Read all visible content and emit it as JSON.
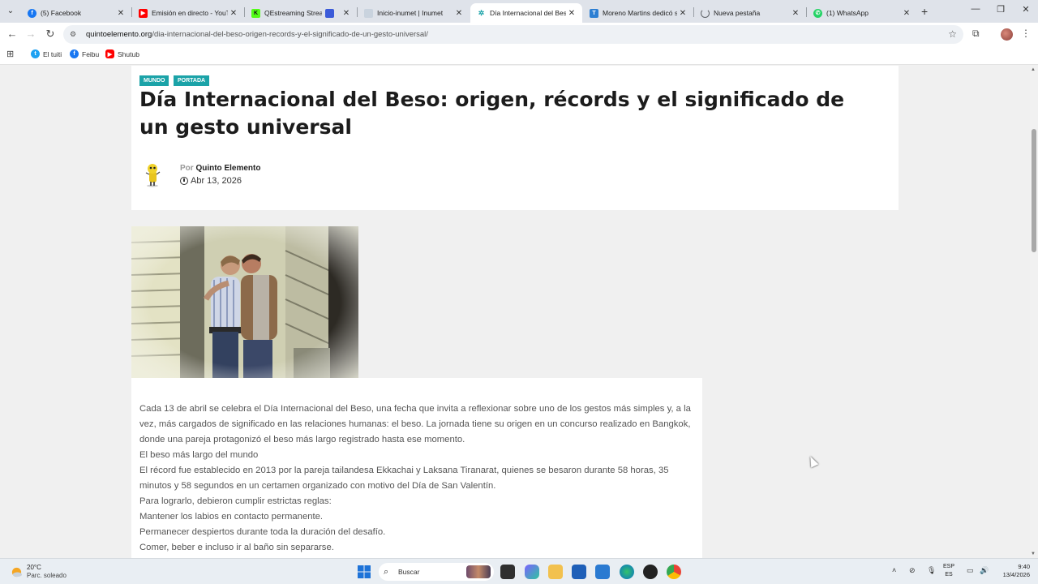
{
  "browser": {
    "tabs": [
      {
        "title": "(5) Facebook",
        "icon": "facebook-icon",
        "color": "#1877f2"
      },
      {
        "title": "Emisión en directo - YouTube",
        "icon": "youtube-icon",
        "color": "#ff0000"
      },
      {
        "title": "QEstreaming Stream",
        "icon": "kick-icon",
        "color": "#53fc18"
      },
      {
        "title": "Inicio-inumet | Inumet",
        "icon": "page-icon",
        "color": "#c9d3de"
      },
      {
        "title": "Día Internacional del Beso",
        "icon": "site-icon",
        "color": "#1ba3a8",
        "active": true
      },
      {
        "title": "Moreno Martins dedicó su",
        "icon": "doc-icon",
        "color": "#2d7fd3"
      },
      {
        "title": "Nueva pestaña",
        "icon": "loading-icon",
        "color": "#5f6368"
      },
      {
        "title": "(1) WhatsApp",
        "icon": "whatsapp-icon",
        "color": "#25d366"
      }
    ],
    "url_host": "quintoelemento.org",
    "url_path": "/dia-internacional-del-beso-origen-records-y-el-significado-de-un-gesto-universal/",
    "bookmarks": [
      {
        "label": "El tuiti",
        "icon": "twitter-icon",
        "color": "#1da1f2"
      },
      {
        "label": "Feibu",
        "icon": "facebook-icon",
        "color": "#1877f2"
      },
      {
        "label": "Shutub",
        "icon": "youtube-icon",
        "color": "#ff0000"
      }
    ]
  },
  "article": {
    "categories": [
      "MUNDO",
      "PORTADA"
    ],
    "title": "Día Internacional del Beso: origen, récords y el significado de un gesto universal",
    "by_prefix": "Por",
    "author": "Quinto Elemento",
    "date": "Abr 13, 2026",
    "paragraphs": [
      "Cada 13 de abril se celebra el Día Internacional del Beso, una fecha que invita a reflexionar sobre uno de los gestos más simples y, a la vez, más cargados de significado en las relaciones humanas: el beso. La jornada tiene su origen en un concurso realizado en Bangkok, donde una pareja protagonizó el beso más largo registrado hasta ese momento.",
      "El beso más largo del mundo",
      "El récord fue establecido en 2013 por la pareja tailandesa Ekkachai y Laksana Tiranarat, quienes se besaron durante 58 horas, 35 minutos y 58 segundos en un certamen organizado con motivo del Día de San Valentín.",
      "Para lograrlo, debieron cumplir estrictas reglas:",
      "Mantener los labios en contacto permanente.",
      "Permanecer despiertos durante toda la duración del desafío.",
      "Comer, beber e incluso ir al baño sin separarse."
    ]
  },
  "taskbar": {
    "temp": "20°C",
    "weather": "Parc. soleado",
    "search_placeholder": "Buscar",
    "lang_top": "ESP",
    "lang_bottom": "ES",
    "time": "9:40",
    "date": "13/4/2026"
  },
  "colors": {
    "accent": "#1ba3a8",
    "page_bg": "#f0f0f0"
  }
}
